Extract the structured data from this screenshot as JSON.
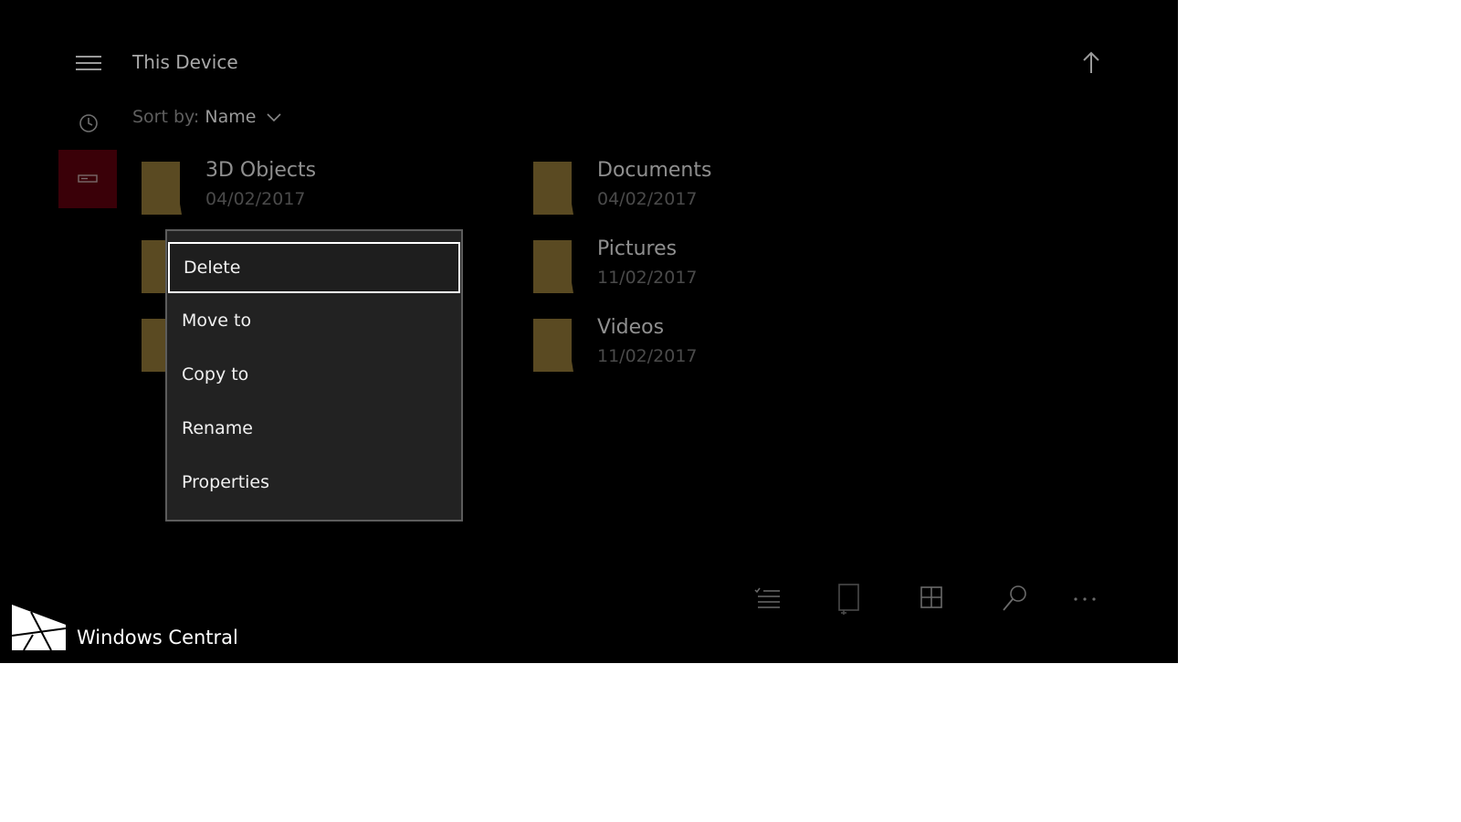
{
  "header": {
    "title": "This Device"
  },
  "sort": {
    "label": "Sort by:",
    "value": "Name"
  },
  "folders": [
    {
      "name": "3D Objects",
      "date": "04/02/2017"
    },
    {
      "name": "Documents",
      "date": "04/02/2017"
    },
    {
      "name": "Pictures",
      "date": "11/02/2017"
    },
    {
      "name": "Videos",
      "date": "11/02/2017"
    }
  ],
  "context_menu": {
    "items": [
      {
        "label": "Delete",
        "focused": true
      },
      {
        "label": "Move to"
      },
      {
        "label": "Copy to"
      },
      {
        "label": "Rename"
      },
      {
        "label": "Properties"
      }
    ]
  },
  "toolbar": {
    "icons": [
      "select-list-icon",
      "new-folder-icon",
      "grid-view-icon",
      "search-icon",
      "more-icon"
    ]
  },
  "watermark": {
    "text": "Windows Central"
  },
  "colors": {
    "background": "#000000",
    "folder": "#5a4a22",
    "nav_selected": "#3a0008",
    "menu_background": "#222222",
    "menu_text": "#f0f0f0"
  }
}
